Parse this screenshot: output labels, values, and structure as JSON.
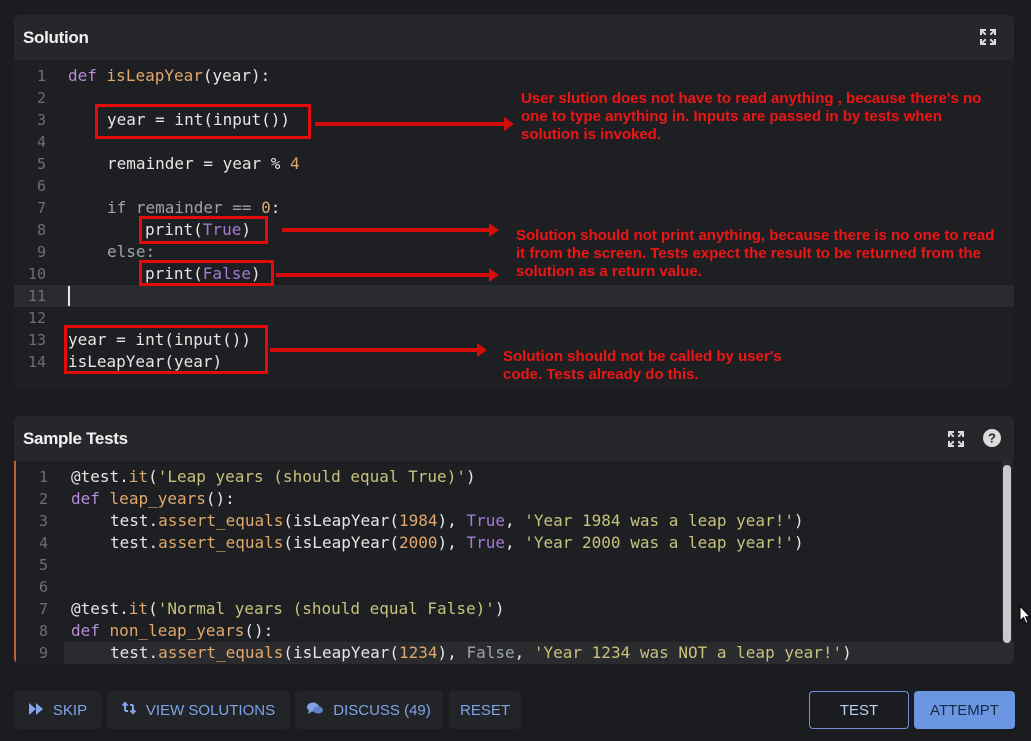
{
  "solution": {
    "title": "Solution",
    "lines": [
      {
        "n": "1"
      },
      {
        "n": "2"
      },
      {
        "n": "3"
      },
      {
        "n": "4"
      },
      {
        "n": "5"
      },
      {
        "n": "6"
      },
      {
        "n": "7"
      },
      {
        "n": "8"
      },
      {
        "n": "9"
      },
      {
        "n": "10"
      },
      {
        "n": "11"
      },
      {
        "n": "12"
      },
      {
        "n": "13"
      },
      {
        "n": "14"
      }
    ],
    "code": {
      "l1_def": "def",
      "l1_fn": "isLeapYear",
      "l1_rest": "(year):",
      "l3": "year = int(input())",
      "l5_a": "remainder = year % ",
      "l5_num": "4",
      "l7_a": "if remainder == ",
      "l7_num": "0",
      "l7_b": ":",
      "l8_a": "print(",
      "l8_bool": "True",
      "l8_b": ")",
      "l9": "else:",
      "l10_a": "print(",
      "l10_bool": "False",
      "l10_b": ")",
      "l13": "year = int(input())",
      "l14": "isLeapYear(year)"
    },
    "annotations": {
      "note1": "User slution does not have to read anything , because there's no one to type anything in. Inputs are passed in by tests when solution is invoked.",
      "note2": "Solution should not print anything, because there is no one to read it from the screen. Tests expect the result to be returned from the solution as a return value.",
      "note3": "Solution should not be called by user's code. Tests already do this."
    }
  },
  "sample_tests": {
    "title": "Sample Tests",
    "lines": [
      {
        "n": "1"
      },
      {
        "n": "2"
      },
      {
        "n": "3"
      },
      {
        "n": "4"
      },
      {
        "n": "5"
      },
      {
        "n": "6"
      },
      {
        "n": "7"
      },
      {
        "n": "8"
      },
      {
        "n": "9"
      }
    ],
    "code": {
      "t1_a": "@test.",
      "t1_fn": "it",
      "t1_b": "(",
      "t1_str": "'Leap years (should equal True)'",
      "t1_c": ")",
      "t2_def": "def",
      "t2_fn": "leap_years",
      "t2_rest": "():",
      "t3_a": "test.",
      "t3_fn": "assert_equals",
      "t3_b": "(isLeapYear(",
      "t3_num": "1984",
      "t3_c": "), ",
      "t3_bool": "True",
      "t3_d": ", ",
      "t3_str": "'Year 1984 was a leap year!'",
      "t3_e": ")",
      "t4_a": "test.",
      "t4_fn": "assert_equals",
      "t4_b": "(isLeapYear(",
      "t4_num": "2000",
      "t4_c": "), ",
      "t4_bool": "True",
      "t4_d": ", ",
      "t4_str": "'Year 2000 was a leap year!'",
      "t4_e": ")",
      "t7_a": "@test.",
      "t7_fn": "it",
      "t7_b": "(",
      "t7_str": "'Normal years (should equal False)'",
      "t7_c": ")",
      "t8_def": "def",
      "t8_fn": "non_leap_years",
      "t8_rest": "():",
      "t9_a": "test.",
      "t9_fn": "assert_equals",
      "t9_b": "(isLeapYear(",
      "t9_num": "1234",
      "t9_c": "), ",
      "t9_bool": "False",
      "t9_d": ", ",
      "t9_str": "'Year 1234 was NOT a leap year!'",
      "t9_e": ")"
    }
  },
  "footer": {
    "skip": "SKIP",
    "view_solutions": "VIEW SOLUTIONS",
    "discuss": "DISCUSS (49)",
    "reset": "RESET",
    "test": "TEST",
    "attempt": "ATTEMPT"
  },
  "colors": {
    "accent": "#6a96e2",
    "annotation_red": "#ee1515",
    "background": "#1b1c1f"
  },
  "icons": [
    "expand-icon",
    "help-icon",
    "skip-forward-icon",
    "swap-arrows-icon",
    "chat-bubbles-icon",
    "mouse-cursor-icon"
  ]
}
